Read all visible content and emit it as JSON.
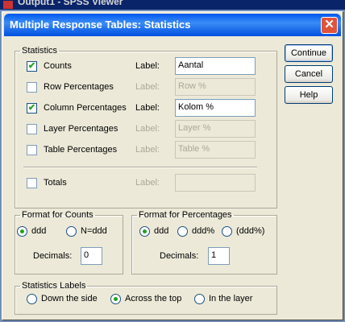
{
  "background_window": {
    "title": "Output1 - SPSS Viewer"
  },
  "dialog": {
    "title": "Multiple Response Tables: Statistics",
    "close_symbol": "✕"
  },
  "statistics": {
    "legend": "Statistics",
    "label_text": "Label:",
    "rows": [
      {
        "name": "Counts",
        "checked": true,
        "label_value": "Aantal",
        "enabled": true
      },
      {
        "name": "Row Percentages",
        "checked": false,
        "label_value": "Row %",
        "enabled": false
      },
      {
        "name": "Column Percentages",
        "checked": true,
        "label_value": "Kolom %",
        "enabled": true
      },
      {
        "name": "Layer Percentages",
        "checked": false,
        "label_value": "Layer %",
        "enabled": false
      },
      {
        "name": "Table Percentages",
        "checked": false,
        "label_value": "Table %",
        "enabled": false
      }
    ],
    "totals": {
      "name": "Totals",
      "checked": false,
      "label_value": "",
      "enabled": false
    }
  },
  "format_counts": {
    "legend": "Format for Counts",
    "options": [
      "ddd",
      "N=ddd"
    ],
    "selected": "ddd",
    "decimals_label": "Decimals:",
    "decimals_value": "0"
  },
  "format_percentages": {
    "legend": "Format for Percentages",
    "options": [
      "ddd",
      "ddd%",
      "(ddd%)"
    ],
    "selected": "ddd",
    "decimals_label": "Decimals:",
    "decimals_value": "1"
  },
  "statistics_labels": {
    "legend": "Statistics Labels",
    "options": [
      "Down the side",
      "Across the top",
      "In the layer"
    ],
    "selected": "Across the top"
  },
  "buttons": {
    "continue": "Continue",
    "cancel": "Cancel",
    "help": "Help"
  },
  "check_mark": "✔"
}
